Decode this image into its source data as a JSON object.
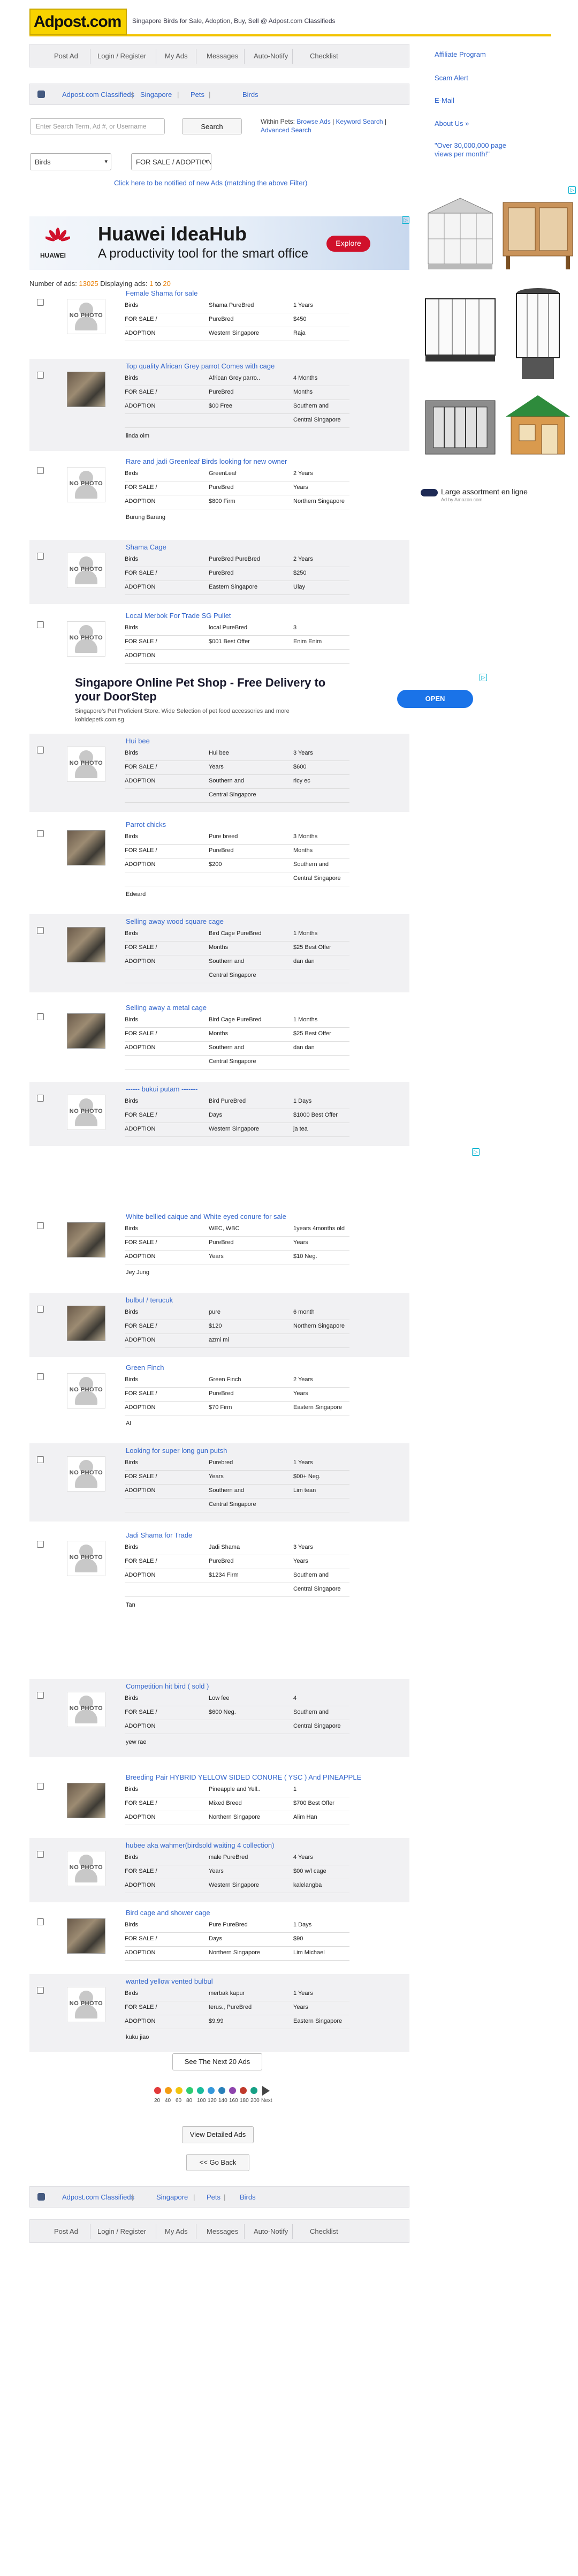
{
  "header": {
    "logo_text": "Adpost",
    "logo_suffix": ".com",
    "tagline": "Singapore Birds for Sale, Adoption, Buy, Sell @ Adpost.com Classifieds"
  },
  "nav": [
    "Post Ad",
    "Login / Register",
    "My Ads",
    "Messages",
    "Auto-Notify",
    "Checklist"
  ],
  "nav_bottom": [
    "Post Ad",
    "Login / Register",
    "My Ads",
    "Messages",
    "Auto-Notify",
    "Checklist"
  ],
  "breadcrumb": [
    "Adpost.com Classifieds",
    "Singapore",
    "Pets",
    "Birds"
  ],
  "search": {
    "placeholder": "Enter Search Term, Ad #, or Username",
    "button": "Search",
    "within_label": "Within Pets:",
    "browse_ads": "Browse Ads",
    "keyword_search": "Keyword Search",
    "advanced_search": "Advanced Search",
    "category_select": "Birds",
    "type_select": "FOR SALE / ADOPTION",
    "notify_link": "Click here to be notified of new Ads (matching the above Filter)"
  },
  "sidebar": {
    "links": [
      "Affiliate Program",
      "Scam Alert",
      "E-Mail",
      "About Us »"
    ],
    "promo": "\"Over 30,000,000 page views per month!\"",
    "ad_caption": "Large assortment en ligne",
    "ad_sub": "Ad by Amazon.com"
  },
  "banner_ad": {
    "brand": "HUAWEI",
    "title": "Huawei IdeaHub",
    "subtitle": "A productivity tool for the smart office",
    "button": "Explore"
  },
  "text_ad": {
    "title": "Singapore Online Pet Shop - Free Delivery to your DoorStep",
    "desc": "Singapore's Pet Proficient Store. Wide Selection of pet food accessories and more",
    "url": "kohidepetk.com.sg",
    "button": "OPEN"
  },
  "ads_count": {
    "label": "Number of ads:",
    "count": "13025",
    "displaying": "Displaying ads:",
    "from": "1",
    "to_word": "to",
    "to": "20"
  },
  "listings": [
    {
      "title": "Female Shama for sale",
      "photo": false,
      "rows": [
        [
          "Birds",
          "Shama PureBred",
          "1 Years"
        ],
        [
          "FOR SALE /",
          "PureBred",
          "$450"
        ],
        [
          "ADOPTION",
          "Western Singapore",
          "Raja"
        ]
      ],
      "extra": ""
    },
    {
      "title": "Top quality African Grey parrot Comes with cage",
      "photo": true,
      "rows": [
        [
          "Birds",
          "African Grey parro..",
          "4 Months"
        ],
        [
          "FOR SALE /",
          "PureBred",
          "Months"
        ],
        [
          "ADOPTION",
          "$00 Free",
          "Southern and"
        ],
        [
          "",
          "",
          "Central Singapore"
        ]
      ],
      "extra": "linda oim"
    },
    {
      "title": "Rare and jadi Greenleaf Birds looking for new owner",
      "photo": false,
      "rows": [
        [
          "Birds",
          "GreenLeaf",
          "2 Years"
        ],
        [
          "FOR SALE /",
          "PureBred",
          "Years"
        ],
        [
          "ADOPTION",
          "$800 Firm",
          "Northern Singapore"
        ]
      ],
      "extra": "Burung Barang"
    },
    {
      "title": "Shama Cage",
      "photo": false,
      "rows": [
        [
          "Birds",
          "PureBred PureBred",
          "2 Years"
        ],
        [
          "FOR SALE /",
          "PureBred",
          "$250"
        ],
        [
          "ADOPTION",
          "Eastern Singapore",
          "Ulay"
        ]
      ],
      "extra": ""
    },
    {
      "title": "Local Merbok For Trade SG Pullet",
      "photo": false,
      "rows": [
        [
          "Birds",
          "local PureBred",
          "3"
        ],
        [
          "FOR SALE /",
          "$001 Best Offer",
          "Enim Enim"
        ],
        [
          "ADOPTION",
          "",
          ""
        ]
      ],
      "extra": ""
    },
    {
      "title": "Hui bee",
      "photo": false,
      "rows": [
        [
          "Birds",
          "Hui bee",
          "3 Years"
        ],
        [
          "FOR SALE /",
          "Years",
          "$600"
        ],
        [
          "ADOPTION",
          "Southern and",
          "ricy ec"
        ],
        [
          "",
          "Central Singapore",
          ""
        ]
      ],
      "extra": ""
    },
    {
      "title": "Parrot chicks",
      "photo": true,
      "rows": [
        [
          "Birds",
          "Pure breed",
          "3 Months"
        ],
        [
          "FOR SALE /",
          "PureBred",
          "Months"
        ],
        [
          "ADOPTION",
          "$200",
          "Southern and"
        ],
        [
          "",
          "",
          "Central Singapore"
        ]
      ],
      "extra": "Edward"
    },
    {
      "title": "Selling away wood square cage",
      "photo": true,
      "rows": [
        [
          "Birds",
          "Bird Cage PureBred",
          "1 Months"
        ],
        [
          "FOR SALE /",
          "Months",
          "$25 Best Offer"
        ],
        [
          "ADOPTION",
          "Southern and",
          "dan dan"
        ],
        [
          "",
          "Central Singapore",
          ""
        ]
      ],
      "extra": ""
    },
    {
      "title": "Selling away a metal cage",
      "photo": true,
      "rows": [
        [
          "Birds",
          "Bird Cage PureBred",
          "1 Months"
        ],
        [
          "FOR SALE /",
          "Months",
          "$25 Best Offer"
        ],
        [
          "ADOPTION",
          "Southern and",
          "dan dan"
        ],
        [
          "",
          "Central Singapore",
          ""
        ]
      ],
      "extra": ""
    },
    {
      "title": "------ bukui putam -------",
      "photo": false,
      "rows": [
        [
          "Birds",
          "Bird PureBred",
          "1 Days"
        ],
        [
          "FOR SALE /",
          "Days",
          "$1000 Best Offer"
        ],
        [
          "ADOPTION",
          "Western Singapore",
          "ja tea"
        ]
      ],
      "extra": ""
    },
    {
      "title": "White bellied caique and White eyed conure for sale",
      "photo": true,
      "rows": [
        [
          "Birds",
          "WEC, WBC",
          "1years 4months old"
        ],
        [
          "FOR SALE /",
          "PureBred",
          "Years"
        ],
        [
          "ADOPTION",
          "Years",
          "$10 Neg."
        ]
      ],
      "extra": "Jey Jung"
    },
    {
      "title": "bulbul / terucuk",
      "photo": true,
      "rows": [
        [
          "Birds",
          "pure",
          "6 month"
        ],
        [
          "FOR SALE /",
          "$120",
          "Northern Singapore"
        ],
        [
          "ADOPTION",
          "azmi mi",
          ""
        ]
      ],
      "extra": ""
    },
    {
      "title": "Green Finch",
      "photo": false,
      "rows": [
        [
          "Birds",
          "Green Finch",
          "2 Years"
        ],
        [
          "FOR SALE /",
          "PureBred",
          "Years"
        ],
        [
          "ADOPTION",
          "$70 Firm",
          "Eastern Singapore"
        ]
      ],
      "extra": "Al"
    },
    {
      "title": "Looking for super long gun putsh",
      "photo": false,
      "rows": [
        [
          "Birds",
          "Purebred",
          "1 Years"
        ],
        [
          "FOR SALE /",
          "Years",
          "$00+ Neg."
        ],
        [
          "ADOPTION",
          "Southern and",
          "Lim tean"
        ],
        [
          "",
          "Central Singapore",
          ""
        ]
      ],
      "extra": ""
    },
    {
      "title": "Jadi Shama for Trade",
      "photo": false,
      "rows": [
        [
          "Birds",
          "Jadi Shama",
          "3 Years"
        ],
        [
          "FOR SALE /",
          "PureBred",
          "Years"
        ],
        [
          "ADOPTION",
          "$1234 Firm",
          "Southern and"
        ],
        [
          "",
          "",
          "Central Singapore"
        ]
      ],
      "extra": "Tan"
    },
    {
      "title": "Competition hit bird ( sold )",
      "photo": false,
      "rows": [
        [
          "Birds",
          "Low fee",
          "4"
        ],
        [
          "FOR SALE /",
          "$600 Neg.",
          "Southern and"
        ],
        [
          "ADOPTION",
          "",
          "Central Singapore"
        ]
      ],
      "extra": "yew rae"
    },
    {
      "title": "Breeding Pair HYBRID YELLOW SIDED CONURE ( YSC ) And PINEAPPLE",
      "photo": true,
      "rows": [
        [
          "Birds",
          "Pineapple and Yell..",
          "1"
        ],
        [
          "FOR SALE /",
          "Mixed Breed",
          "$700 Best Offer"
        ],
        [
          "ADOPTION",
          "Northern Singapore",
          "Alim Han"
        ]
      ],
      "extra": ""
    },
    {
      "title": "hubee aka wahmer(birdsold waiting 4 collection)",
      "photo": false,
      "rows": [
        [
          "Birds",
          "male PureBred",
          "4 Years"
        ],
        [
          "FOR SALE /",
          "Years",
          "$00 w/l cage"
        ],
        [
          "ADOPTION",
          "Western Singapore",
          "kalelangba"
        ]
      ],
      "extra": ""
    },
    {
      "title": "Bird cage and shower cage",
      "photo": true,
      "rows": [
        [
          "Birds",
          "Pure PureBred",
          "1 Days"
        ],
        [
          "FOR SALE /",
          "Days",
          "$90"
        ],
        [
          "ADOPTION",
          "Northern Singapore",
          "Lim Michael"
        ]
      ],
      "extra": ""
    },
    {
      "title": "wanted yellow vented bulbul",
      "photo": false,
      "rows": [
        [
          "Birds",
          "merbak kapur",
          "1 Years"
        ],
        [
          "FOR SALE /",
          "terus., PureBred",
          "Years"
        ],
        [
          "ADOPTION",
          "$9.99",
          "Eastern Singapore"
        ]
      ],
      "extra": "kuku jiao"
    }
  ],
  "next_button": "See The Next 20 Ads",
  "pager": [
    "20",
    "40",
    "60",
    "80",
    "100",
    "120",
    "140",
    "160",
    "180",
    "200",
    "Next"
  ],
  "detailed_button": "View Detailed Ads",
  "back_button": "<< Go Back",
  "colors": {
    "accent": "#3366cc",
    "logo_yellow": "#f8d300",
    "count_orange": "#e87e04"
  }
}
